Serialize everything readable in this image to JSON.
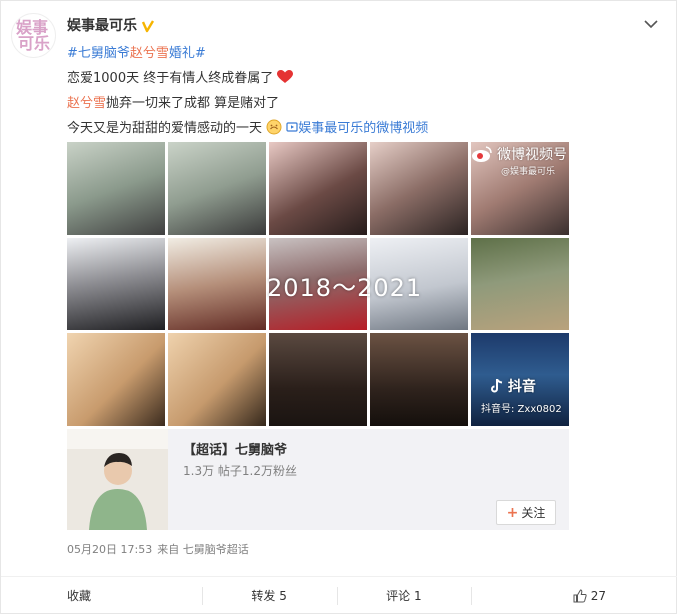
{
  "post": {
    "username": "娱事最可乐",
    "avatar_text": [
      "娱事",
      "可乐"
    ],
    "lines": [
      {
        "topic1": "#七舅脑爷",
        "mention": "赵兮雪",
        "topic2": "婚礼#"
      },
      {
        "text": "恋爱1000天 终于有情人终成眷属了"
      },
      {
        "mention": "赵兮雪",
        "text": "抛弃一切来了成都 算是赌对了"
      },
      {
        "text": "今天又是为甜甜的爱情感动的一天",
        "video_link": "娱事最可乐的微博视频"
      }
    ],
    "overlay_text": "2018～2021",
    "watermark_weibo": "微博视频号",
    "watermark_weibo_sub": "@娱事最可乐",
    "watermark_douyin": "抖音",
    "watermark_douyin_id": "抖音号: Zxx0802"
  },
  "topic_card": {
    "title": "【超话】七舅脑爷",
    "stats": "1.3万  帖子1.2万粉丝",
    "follow_label": "关注"
  },
  "meta": {
    "time": "05月20日 17:53",
    "source": "来自 七舅脑爷超话"
  },
  "footer": {
    "favorite": "收藏",
    "repost": "转发 5",
    "comment": "评论 1",
    "likes": "27"
  },
  "colors": {
    "link": "#eb7350",
    "topic": "#3a7bd5",
    "heart": "#e53333",
    "verified": "#f6b400"
  },
  "icons": [
    "verified-badge-icon",
    "chevron-down-icon",
    "heart-icon",
    "emoji-icon",
    "video-icon",
    "weibo-eye-icon",
    "douyin-icon",
    "plus-icon",
    "thumb-up-icon"
  ]
}
